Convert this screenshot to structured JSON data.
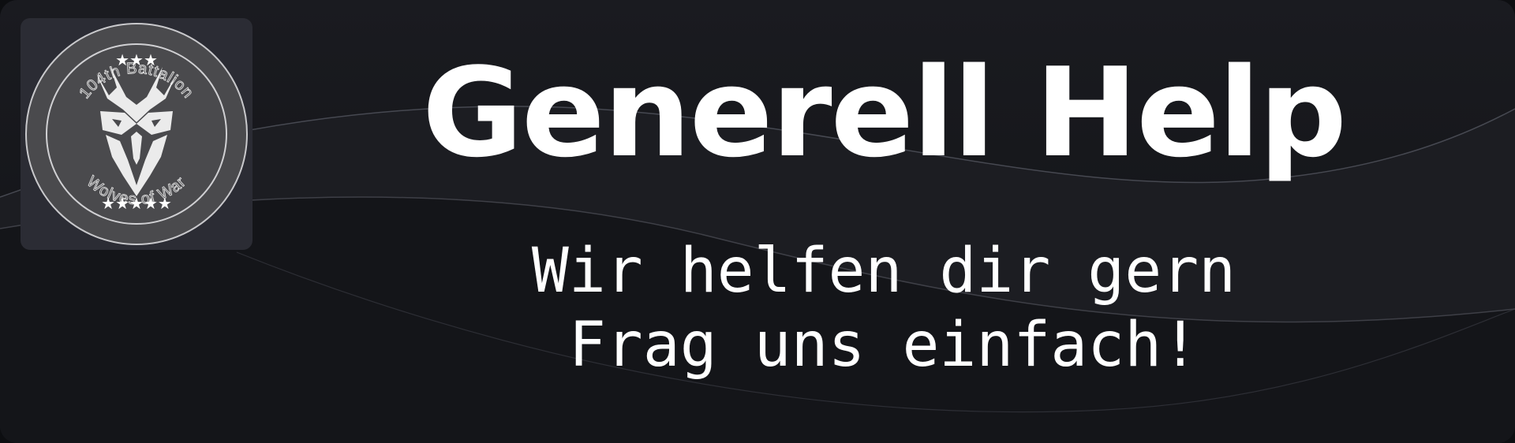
{
  "banner": {
    "title": "Generell Help",
    "subtitle_line1": "Wir helfen dir gern",
    "subtitle_line2": "Frag uns einfach!"
  },
  "logo": {
    "top_text": "104th Battalion",
    "bottom_text": "Wolves of War",
    "top_stars": "★★★",
    "bottom_stars": "★★★★★",
    "icon": "wolf-head-icon"
  },
  "colors": {
    "background": "#15161a",
    "text": "#ffffff",
    "logo_tile": "#2b2c34",
    "logo_badge": "#4a4a4d",
    "wave_line": "#5a5c66"
  }
}
